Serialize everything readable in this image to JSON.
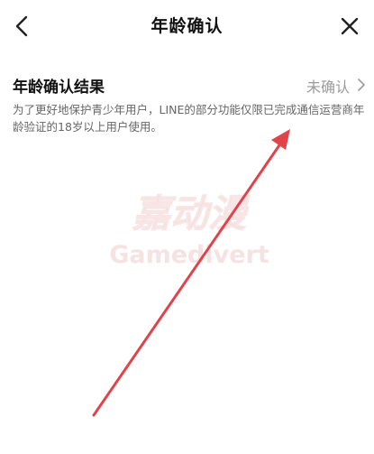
{
  "header": {
    "title": "年龄确认",
    "back_icon": "chevron-left-icon",
    "close_icon": "close-icon"
  },
  "age_confirmation": {
    "label": "年龄确认结果",
    "status": "未确认",
    "chevron_icon": "chevron-right-icon",
    "description": "为了更好地保护青少年用户，LINE的部分功能仅限已完成通信运营商年龄验证的18岁以上用户使用。"
  },
  "overlay": {
    "watermark_text_cn": "嘉动漫",
    "watermark_text_en": "Gamedivert",
    "watermark_color": "#f3dada",
    "arrow_color": "#e0444a"
  }
}
